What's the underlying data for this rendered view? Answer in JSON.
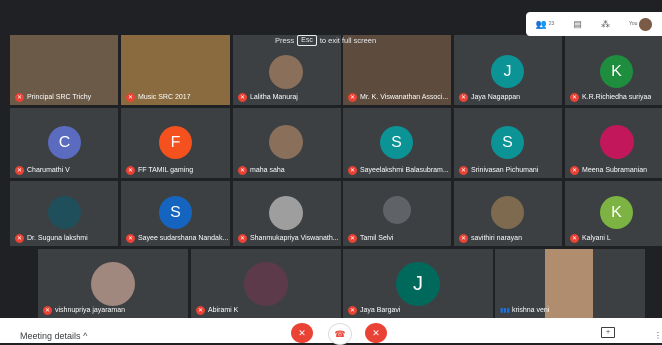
{
  "fullscreen_toast": {
    "before": "Press",
    "key": "Esc",
    "after": "to exit full screen"
  },
  "topbar": {
    "participant_count": "23",
    "self_label": "You"
  },
  "colors": {
    "mute_badge": "#ea4335",
    "tile_bg": "#3c4043",
    "stage_bg": "#202124",
    "hangup": "#ea4335"
  },
  "participants": [
    {
      "name": "Principal SRC Trichy",
      "kind": "video"
    },
    {
      "name": "Music SRC 2017",
      "kind": "video"
    },
    {
      "name": "Lalitha Manuraj",
      "kind": "photo"
    },
    {
      "name": "Mr. K. Viswanathan Associ...",
      "kind": "video"
    },
    {
      "name": "Jaya Nagappan",
      "kind": "letter",
      "letter": "J",
      "color": "#0b9396"
    },
    {
      "name": "K.R.Richiedha suriyaa",
      "kind": "letter",
      "letter": "K",
      "color": "#1e8e3e"
    },
    {
      "name": "Charumathi V",
      "kind": "letter",
      "letter": "C",
      "color": "#5b6bc0"
    },
    {
      "name": "FF TAMIL gaming",
      "kind": "letter",
      "letter": "F",
      "color": "#f4511e"
    },
    {
      "name": "maha saha",
      "kind": "photo"
    },
    {
      "name": "Sayeelakshmi Balasubram...",
      "kind": "letter",
      "letter": "S",
      "color": "#0b9396"
    },
    {
      "name": "Srinivasan Pichumani",
      "kind": "letter",
      "letter": "S",
      "color": "#0b9396"
    },
    {
      "name": "Meena Subramanian",
      "kind": "photo"
    },
    {
      "name": "Dr. Suguna lakshmi",
      "kind": "photo"
    },
    {
      "name": "Sayee sudarshana Nandak...",
      "kind": "letter",
      "letter": "S",
      "color": "#1565c0"
    },
    {
      "name": "Shanmukapriya Viswanath...",
      "kind": "photo"
    },
    {
      "name": "Tamil Selvi",
      "kind": "photo"
    },
    {
      "name": "savithiri narayan",
      "kind": "photo"
    },
    {
      "name": "Kalyani L",
      "kind": "letter",
      "letter": "K",
      "color": "#7cb342"
    },
    {
      "name": "vishnupriya jayaraman",
      "kind": "photo"
    },
    {
      "name": "Abirami K",
      "kind": "photo"
    },
    {
      "name": "Jaya Bargavi",
      "kind": "letter",
      "letter": "J",
      "color": "#00695c"
    },
    {
      "name": "krishna veni",
      "kind": "video"
    }
  ],
  "bottombar": {
    "meeting_details": "Meeting details",
    "present_glyph": "+",
    "more_glyph": "⋮"
  }
}
